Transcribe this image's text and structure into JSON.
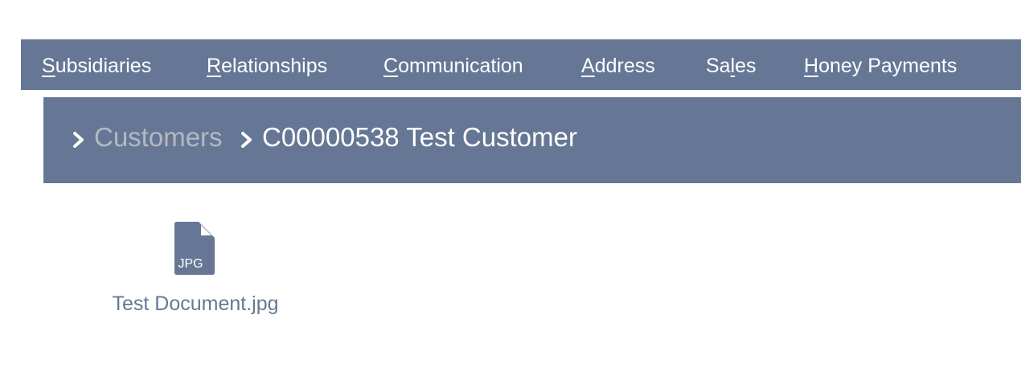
{
  "tabs": [
    {
      "hotkey": "S",
      "pre": "",
      "post": "ubsidiaries"
    },
    {
      "hotkey": "R",
      "pre": "",
      "post": "elationships"
    },
    {
      "hotkey": "C",
      "pre": "",
      "post": "ommunication"
    },
    {
      "hotkey": "A",
      "pre": "",
      "post": "ddress"
    },
    {
      "hotkey": "l",
      "pre": "Sa",
      "post": "es"
    },
    {
      "hotkey": "H",
      "pre": "",
      "post": "oney Payments"
    }
  ],
  "breadcrumb": {
    "parent": "Customers",
    "current": "C00000538 Test Customer"
  },
  "file": {
    "type_label": "JPG",
    "name": "Test Document.jpg"
  },
  "colors": {
    "accent": "#667795",
    "muted_link": "#b4b8c1",
    "text_on_accent": "#ffffff"
  }
}
